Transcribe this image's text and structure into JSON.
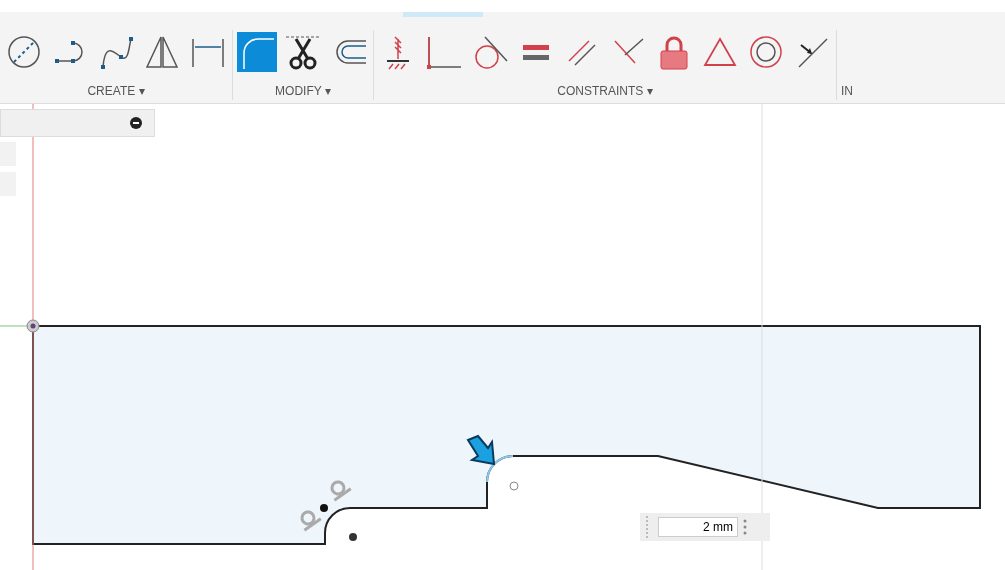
{
  "toolbar": {
    "groups": [
      {
        "label": "CREATE ▾",
        "tools": [
          {
            "kind": "circle",
            "selected": false
          },
          {
            "kind": "slot",
            "selected": false
          },
          {
            "kind": "spline",
            "selected": false
          },
          {
            "kind": "mirror",
            "selected": false
          },
          {
            "kind": "dimension",
            "selected": false
          }
        ]
      },
      {
        "label": "MODIFY ▾",
        "tools": [
          {
            "kind": "fillet",
            "selected": true
          },
          {
            "kind": "trim",
            "selected": false
          },
          {
            "kind": "offset",
            "selected": false
          }
        ]
      },
      {
        "label": "CONSTRAINTS ▾",
        "tools": [
          {
            "kind": "fix",
            "selected": false
          },
          {
            "kind": "coincident",
            "selected": false
          },
          {
            "kind": "tangent",
            "selected": false
          },
          {
            "kind": "equal",
            "selected": false
          },
          {
            "kind": "parallel",
            "selected": false
          },
          {
            "kind": "perpendicular",
            "selected": false
          },
          {
            "kind": "lock",
            "selected": false
          },
          {
            "kind": "triangle",
            "selected": false
          },
          {
            "kind": "concentric",
            "selected": false
          },
          {
            "kind": "midpoint",
            "selected": false
          }
        ]
      },
      {
        "label": "IN"
      }
    ]
  },
  "dimension_input": {
    "value": "2 mm"
  }
}
